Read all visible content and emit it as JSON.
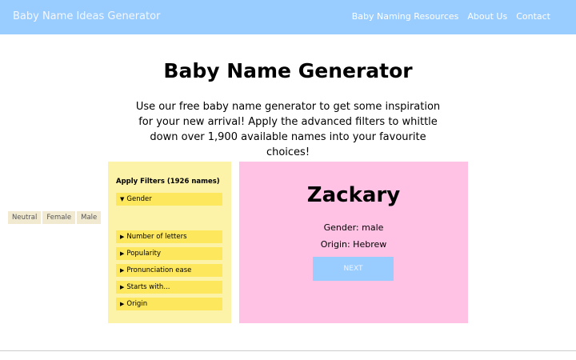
{
  "header": {
    "brand": "Baby Name Ideas Generator",
    "nav": [
      "Baby Naming Resources",
      "About Us",
      "Contact"
    ]
  },
  "main": {
    "title": "Baby Name Generator",
    "intro": "Use our free baby name generator to get some inspiration for your new arrival! Apply the advanced filters to whittle down over 1,900 available names into your favourite choices!"
  },
  "filters": {
    "title": "Apply Filters (1926 names)",
    "gender": {
      "label": "Gender",
      "expanded": true,
      "options": [
        "Neutral",
        "Female",
        "Male"
      ]
    },
    "sections": [
      "Number of letters",
      "Popularity",
      "Pronunciation ease",
      "Starts with...",
      "Origin"
    ]
  },
  "result": {
    "name": "Zackary",
    "gender": "Gender: male",
    "origin": "Origin: Hebrew",
    "next_label": "NEXT"
  },
  "colors": {
    "header_bg": "#99ccff",
    "filters_bg": "#fcf3a8",
    "filter_bar": "#fde75d",
    "result_bg": "#ffc2e4",
    "button_bg": "#99ccff"
  }
}
